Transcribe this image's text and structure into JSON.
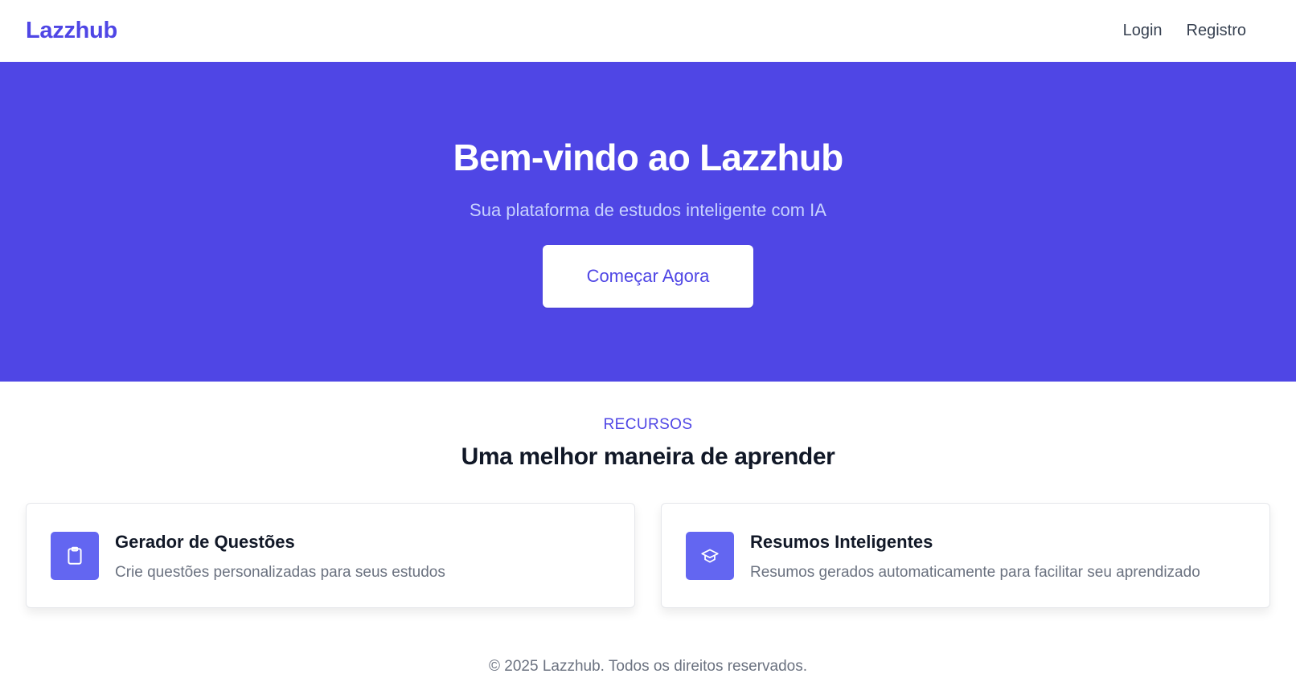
{
  "brand": {
    "name": "Lazzhub",
    "accent_color": "#4f46e5"
  },
  "nav": {
    "links": [
      {
        "label": "Login"
      },
      {
        "label": "Registro"
      }
    ]
  },
  "hero": {
    "title": "Bem-vindo ao Lazzhub",
    "subtitle": "Sua plataforma de estudos inteligente com IA",
    "cta_label": "Começar Agora",
    "background_color": "#4f46e5"
  },
  "features": {
    "eyebrow": "RECURSOS",
    "title": "Uma melhor maneira de aprender",
    "cards": [
      {
        "icon": "clipboard-icon",
        "title": "Gerador de Questões",
        "description": "Crie questões personalizadas para seus estudos"
      },
      {
        "icon": "graduation-cap-icon",
        "title": "Resumos Inteligentes",
        "description": "Resumos gerados automaticamente para facilitar seu aprendizado"
      }
    ]
  },
  "footer": {
    "text": "© 2025 Lazzhub. Todos os direitos reservados."
  }
}
